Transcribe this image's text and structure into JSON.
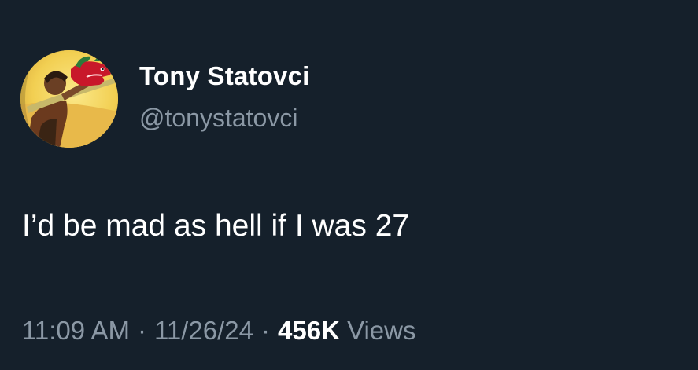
{
  "author": {
    "display_name": "Tony Statovci",
    "handle": "@tonystatovci",
    "avatar_icon": "cartoon-character-avatar"
  },
  "tweet": {
    "text": "I’d be mad as hell if I was 27"
  },
  "meta": {
    "time": "11:09 AM",
    "separator": "·",
    "date": "11/26/24",
    "views_count": "456K",
    "views_label": "Views"
  },
  "colors": {
    "background": "#15202b",
    "primary_text": "#ffffff",
    "secondary_text": "#8b98a5"
  }
}
